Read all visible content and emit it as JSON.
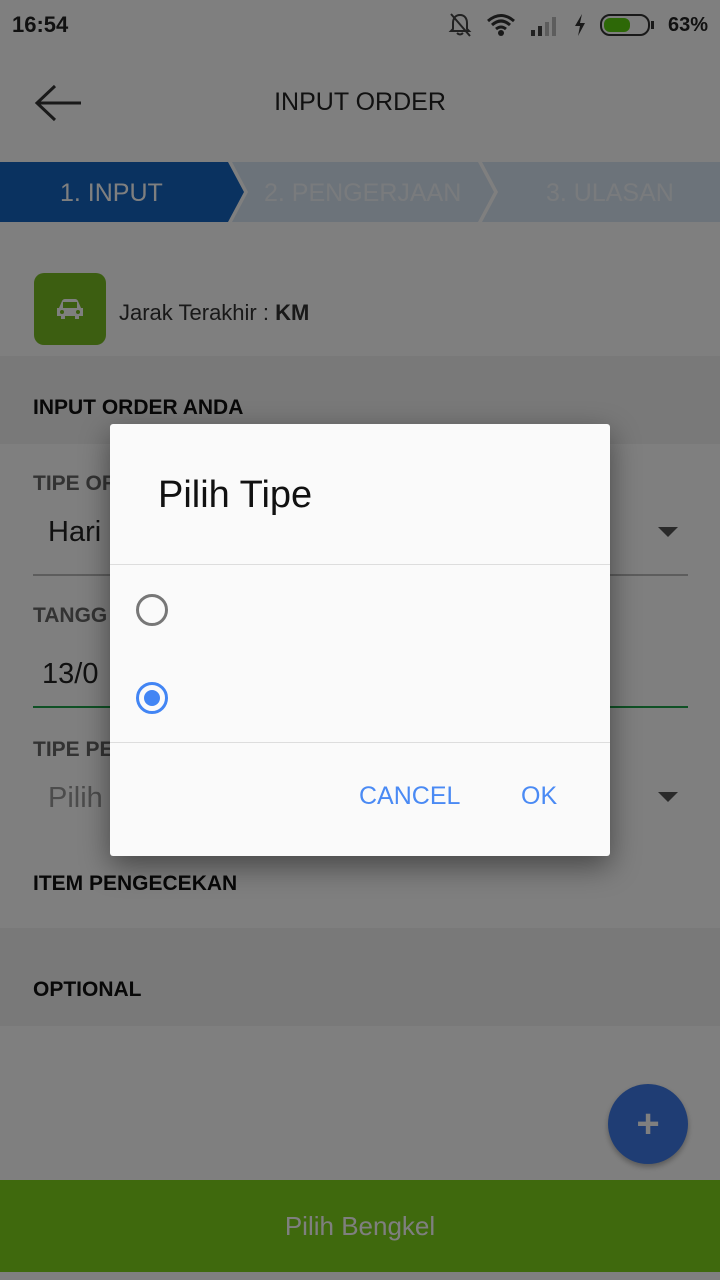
{
  "status_bar": {
    "time": "16:54",
    "battery_percent": "63%",
    "battery_level": 0.63,
    "icons": [
      "notifications-off-icon",
      "wifi-icon",
      "signal-icon",
      "charging-icon",
      "battery-icon"
    ]
  },
  "app_bar": {
    "title": "INPUT ORDER",
    "back_icon": "arrow-back-icon"
  },
  "stepper": {
    "steps": [
      {
        "label": "1. INPUT",
        "active": true
      },
      {
        "label": "2. PENGERJAAN",
        "active": false
      },
      {
        "label": "3. ULASAN",
        "active": false
      }
    ],
    "active_color": "#1565c0",
    "inactive_color": "#d9e6f5"
  },
  "vehicle": {
    "icon": "car-icon",
    "icon_bg": "#78bd23",
    "jarak_label": "Jarak Terakhir :",
    "jarak_value": "KM"
  },
  "form": {
    "section_title": "INPUT ORDER ANDA",
    "tipe_order_label": "TIPE OR",
    "tipe_order_value": "Hari",
    "tanggal_label": "TANGG",
    "tanggal_value": "13/0",
    "tipe_pe_label": "TIPE PE",
    "tipe_pe_placeholder": "Pilih"
  },
  "sections": {
    "item_pengecekan": "ITEM PENGECEKAN",
    "optional": "OPTIONAL"
  },
  "fab": {
    "icon": "plus-icon"
  },
  "bottom_button": {
    "label": "Pilih Bengkel",
    "color": "#7fd21a"
  },
  "dialog": {
    "title": "Pilih Tipe",
    "options": [
      {
        "label": "",
        "selected": false
      },
      {
        "label": "",
        "selected": true
      }
    ],
    "cancel_label": "CANCEL",
    "ok_label": "OK",
    "accent_color": "#4285f4"
  }
}
